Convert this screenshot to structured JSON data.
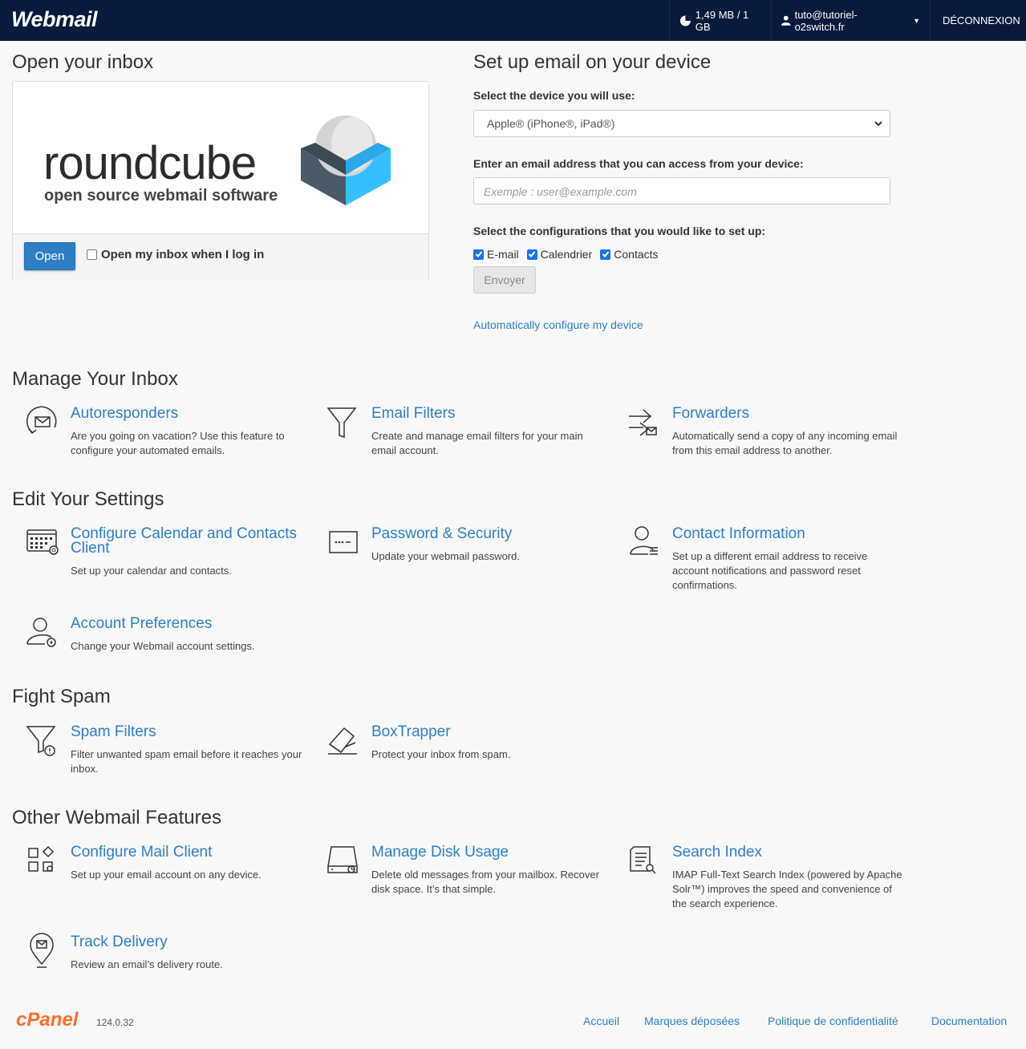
{
  "navbar": {
    "brand": "Webmail",
    "disk_usage": "1,49 MB / 1 GB",
    "user_email": "tuto@tutoriel-o2switch.fr",
    "logout": "DÉCONNEXION"
  },
  "inbox": {
    "heading": "Open your inbox",
    "logo_word": "roundcube",
    "logo_tagline": "open source webmail software",
    "open_button": "Open",
    "auto_open_label": "Open my inbox when I log in"
  },
  "device": {
    "heading": "Set up email on your device",
    "select_label": "Select the device you will use:",
    "select_value": "Apple® (iPhone®, iPad®)",
    "email_label": "Enter an email address that you can access from your device:",
    "email_placeholder": "Exemple : user@example.com",
    "config_label": "Select the configurations that you would like to set up:",
    "configs": [
      "E-mail",
      "Calendrier",
      "Contacts"
    ],
    "send_button": "Envoyer",
    "auto_link": "Automatically configure my device"
  },
  "sections": {
    "manage": "Manage Your Inbox",
    "settings": "Edit Your Settings",
    "spam": "Fight Spam",
    "other": "Other Webmail Features"
  },
  "features": {
    "autoresponders": {
      "title": "Autoresponders",
      "desc": "Are you going on vacation? Use this feature to configure your automated emails.",
      "icon": "autoresponder-icon"
    },
    "email_filters": {
      "title": "Email Filters",
      "desc": "Create and manage email filters for your main email account.",
      "icon": "filter-icon"
    },
    "forwarders": {
      "title": "Forwarders",
      "desc": "Automatically send a copy of any incoming email from this email address to another.",
      "icon": "forward-icon"
    },
    "calendar": {
      "title": "Configure Calendar and Contacts Client",
      "desc": "Set up your calendar and contacts.",
      "icon": "calendar-icon"
    },
    "password": {
      "title": "Password & Security",
      "desc": "Update your webmail password.",
      "icon": "password-icon"
    },
    "contact_info": {
      "title": "Contact Information",
      "desc": "Set up a different email address to receive account notifications and password reset confirmations.",
      "icon": "contact-icon"
    },
    "preferences": {
      "title": "Account Preferences",
      "desc": "Change your Webmail account settings.",
      "icon": "user-gear-icon"
    },
    "spam_filters": {
      "title": "Spam Filters",
      "desc": "Filter unwanted spam email before it reaches your inbox.",
      "icon": "spam-filter-icon"
    },
    "boxtrapper": {
      "title": "BoxTrapper",
      "desc": "Protect your inbox from spam.",
      "icon": "boxtrapper-icon"
    },
    "mail_client": {
      "title": "Configure Mail Client",
      "desc": "Set up your email account on any device.",
      "icon": "apps-icon"
    },
    "disk_usage": {
      "title": "Manage Disk Usage",
      "desc": "Delete old messages from your mailbox. Recover disk space. It’s that simple.",
      "icon": "disk-icon"
    },
    "search_index": {
      "title": "Search Index",
      "desc": "IMAP Full-Text Search Index (powered by Apache Solr™) improves the speed and convenience of the search experience.",
      "icon": "search-doc-icon"
    },
    "track_delivery": {
      "title": "Track Delivery",
      "desc": "Review an email’s delivery route.",
      "icon": "location-pin-icon"
    }
  },
  "footer": {
    "logo": "cPanel",
    "version": "124.0.32",
    "links": [
      "Accueil",
      "Marques déposées",
      "Politique de confidentialité",
      "Documentation"
    ]
  },
  "colors": {
    "navbar": "#0a1a3d",
    "link": "#2e7ec6",
    "cpanel": "#ff6c2c",
    "roundcube_blue": "#37beff"
  }
}
